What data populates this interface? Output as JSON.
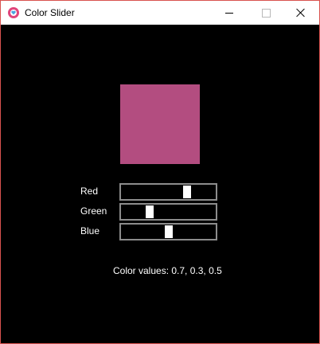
{
  "window": {
    "title": "Color Slider",
    "icon": "app-heart-icon",
    "controls": [
      "minimize-icon",
      "maximize-icon",
      "close-icon"
    ]
  },
  "swatch": {
    "color": "#b34d80"
  },
  "sliders": [
    {
      "label": "Red",
      "value": 0.7
    },
    {
      "label": "Green",
      "value": 0.3
    },
    {
      "label": "Blue",
      "value": 0.5
    }
  ],
  "readout": {
    "text": "Color values: 0.7, 0.3, 0.5"
  },
  "colors": {
    "background": "#000000",
    "track_border": "#8c8c8c",
    "thumb": "#ffffff",
    "titlebar": "#ffffff",
    "window_border": "#d9534f"
  }
}
